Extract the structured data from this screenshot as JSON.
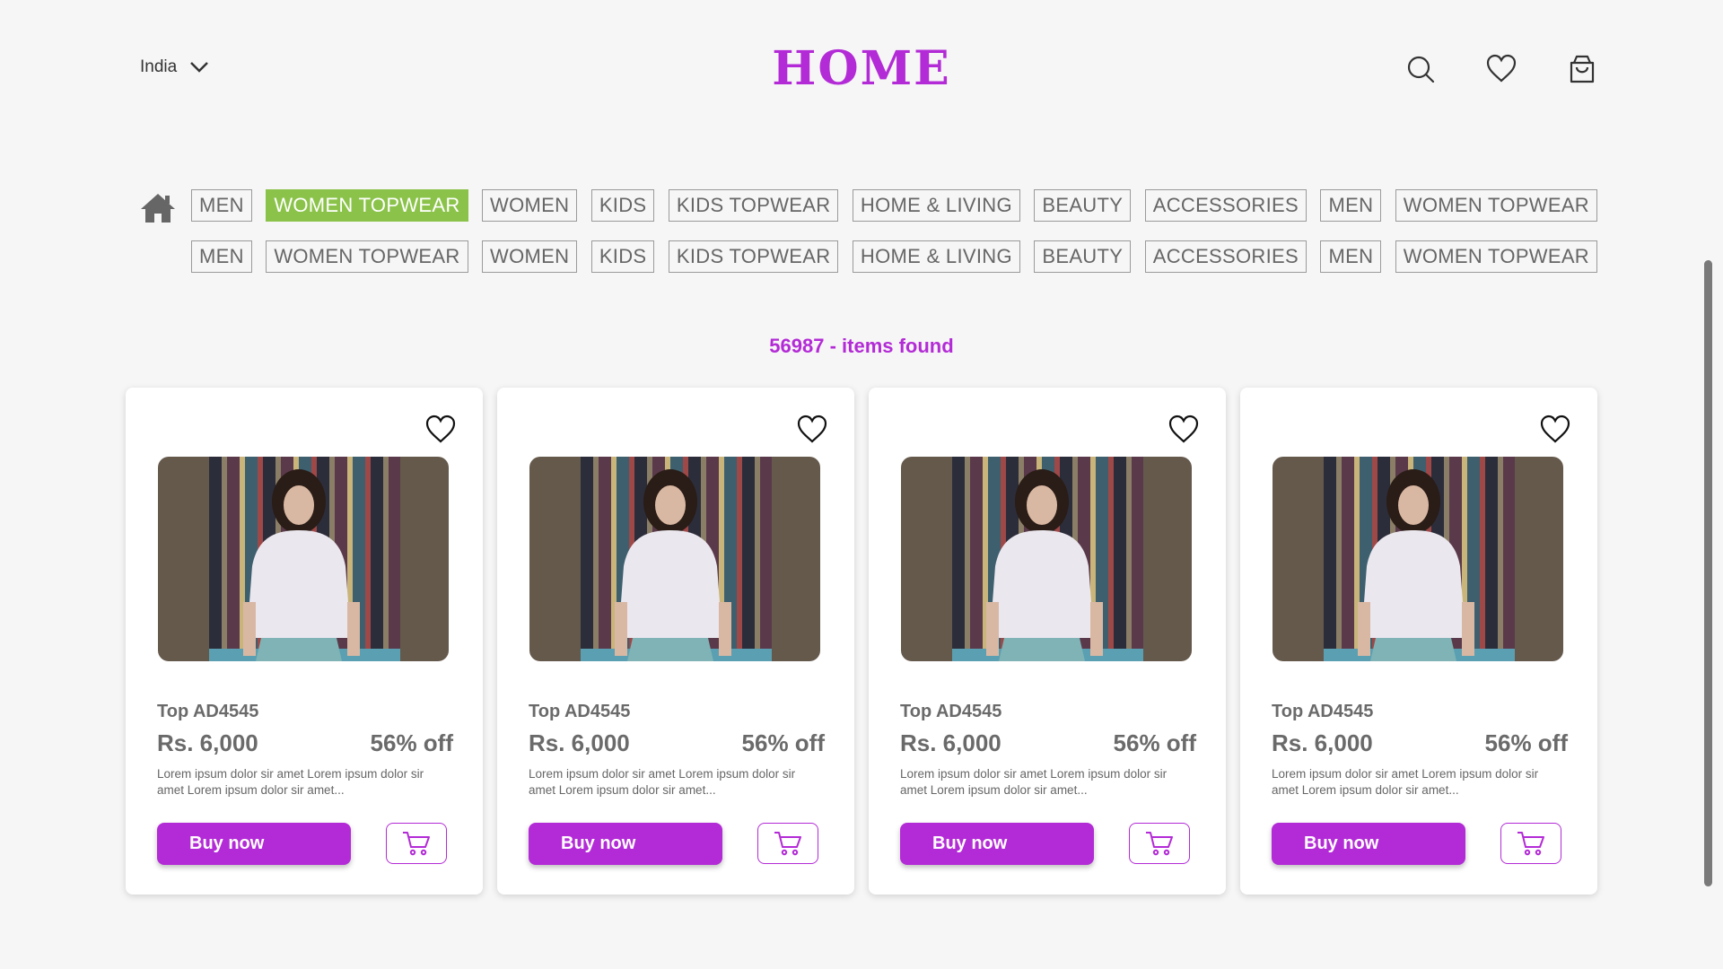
{
  "header": {
    "country": "India",
    "title": "HOME",
    "icons": [
      "search-icon",
      "heart-icon",
      "shopping-bag-icon"
    ]
  },
  "categories": {
    "row1": [
      "MEN",
      "WOMEN TOPWEAR",
      "WOMEN",
      "KIDS",
      "KIDS TOPWEAR",
      "HOME & LIVING",
      "BEAUTY",
      "ACCESSORIES",
      "MEN",
      "WOMEN TOPWEAR"
    ],
    "row2": [
      "MEN",
      "WOMEN TOPWEAR",
      "WOMEN",
      "KIDS",
      "KIDS TOPWEAR",
      "HOME & LIVING",
      "BEAUTY",
      "ACCESSORIES",
      "MEN",
      "WOMEN TOPWEAR"
    ],
    "active": "WOMEN TOPWEAR"
  },
  "results": {
    "label": "56987 - items found"
  },
  "products": [
    {
      "name": "Top AD4545",
      "price": "Rs. 6,000",
      "discount": "56% off",
      "description": "Lorem ipsum dolor sir amet Lorem ipsum dolor sir amet Lorem ipsum dolor sir amet...",
      "buy_label": "Buy now"
    },
    {
      "name": "Top AD4545",
      "price": "Rs. 6,000",
      "discount": "56% off",
      "description": "Lorem ipsum dolor sir amet Lorem ipsum dolor sir amet Lorem ipsum dolor sir amet...",
      "buy_label": "Buy now"
    },
    {
      "name": "Top AD4545",
      "price": "Rs. 6,000",
      "discount": "56% off",
      "description": "Lorem ipsum dolor sir amet Lorem ipsum dolor sir amet Lorem ipsum dolor sir amet...",
      "buy_label": "Buy now"
    },
    {
      "name": "Top AD4545",
      "price": "Rs. 6,000",
      "discount": "56% off",
      "description": "Lorem ipsum dolor sir amet Lorem ipsum dolor sir amet Lorem ipsum dolor sir amet...",
      "buy_label": "Buy now"
    }
  ],
  "colors": {
    "accent": "#b32bd6",
    "active_category": "#8bc34a",
    "background": "#f6f6f6"
  }
}
